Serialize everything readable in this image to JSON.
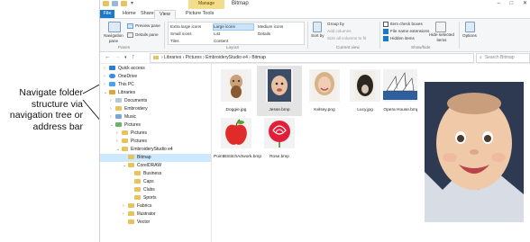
{
  "callout": {
    "text": "Navigate folder structure via navigation tree or address bar"
  },
  "window": {
    "title": "Bitmap",
    "context_tab": "Manage",
    "controls": [
      "–",
      "□",
      "✕"
    ],
    "tabs": [
      "File",
      "Home",
      "Share",
      "View",
      "Picture Tools"
    ],
    "active_tab": "View"
  },
  "ribbon": {
    "panes": {
      "nav_pane": "Navigation pane",
      "preview": "Preview pane",
      "details": "Details pane",
      "label": "Panes"
    },
    "layout": {
      "items": [
        "Extra large icons",
        "Large icons",
        "Medium icons",
        "Small icons",
        "List",
        "Details",
        "Tiles",
        "Content"
      ],
      "selected": "Large icons",
      "label": "Layout"
    },
    "current_view": {
      "sort": "Sort by",
      "group": "Group by",
      "add_cols": "Add columns",
      "size_cols": "Size all columns to fit",
      "label": "Current view"
    },
    "show_hide": {
      "item_check": "Item check boxes",
      "ext": "File name extensions",
      "hidden": "Hidden items",
      "hide_sel": "Hide selected items",
      "label": "Show/hide"
    },
    "options": "Options"
  },
  "nav": {
    "breadcrumb": "› Libraries › Pictures › EmbroideryStudio e4 › Bitmap",
    "search_placeholder": "Search Bitmap"
  },
  "tree": {
    "items": [
      "Quick access",
      "OneDrive",
      "This PC",
      "Libraries",
      "Documents",
      "Embroidery",
      "Music",
      "Pictures",
      "Pictures",
      "Pictures",
      "EmbroideryStudio e4",
      "Bitmap",
      "CorelDRAW",
      "Business",
      "Caps",
      "Clubs",
      "Sports",
      "Fabrics",
      "Illustrator",
      "Vector"
    ]
  },
  "files": [
    {
      "name": "Doggie.jpg"
    },
    {
      "name": "Jesse.bmp"
    },
    {
      "name": "Kelsey.png"
    },
    {
      "name": "Lucy.jpg"
    },
    {
      "name": "Opera House.bmp"
    },
    {
      "name": "PointBStitchArtwork.bmp"
    },
    {
      "name": "Rose.bmp"
    }
  ],
  "colors": {
    "accent": "#1979ca",
    "context_tab": "#f4dd8a",
    "selection": "#cde8ff",
    "folder": "#e8c25a"
  }
}
